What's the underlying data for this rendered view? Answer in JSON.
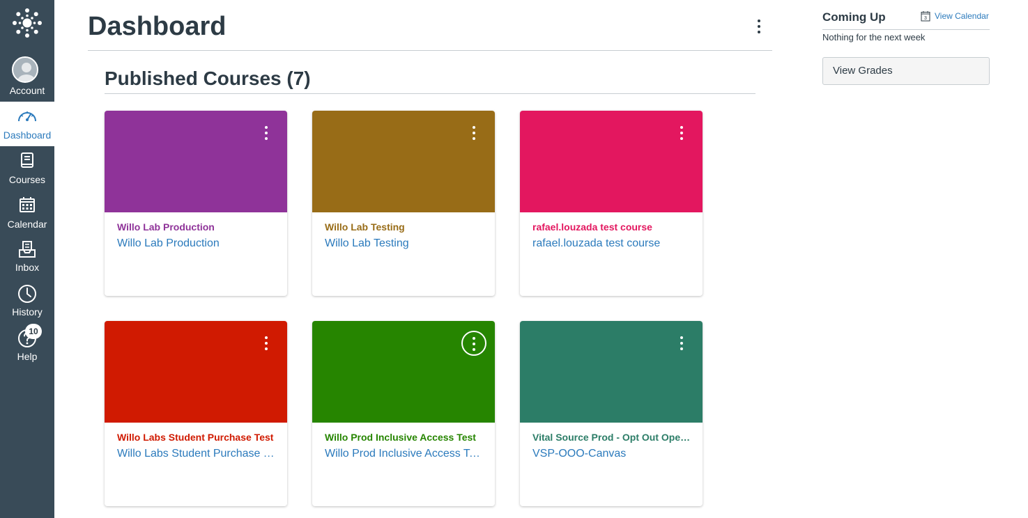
{
  "nav": {
    "account": "Account",
    "dashboard": "Dashboard",
    "courses": "Courses",
    "calendar": "Calendar",
    "inbox": "Inbox",
    "history": "History",
    "help": "Help",
    "help_badge": "10"
  },
  "header": {
    "title": "Dashboard"
  },
  "section": {
    "title": "Published Courses (7)"
  },
  "courses": [
    {
      "name": "Willo Lab Production",
      "code": "Willo Lab Production",
      "color": "#8f3399"
    },
    {
      "name": "Willo Lab Testing",
      "code": "Willo Lab Testing",
      "color": "#986c17"
    },
    {
      "name": "rafael.louzada test course",
      "code": "rafael.louzada test course",
      "color": "#e3175f"
    },
    {
      "name": "Willo Labs Student Purchase Test",
      "code": "Willo Labs Student Purchase Test",
      "color": "#d01a01"
    },
    {
      "name": "Willo Prod Inclusive Access Test",
      "code": "Willo Prod Inclusive Access Test",
      "color": "#268500"
    },
    {
      "name": "Vital Source Prod - Opt Out Open Access",
      "code": "VSP-OOO-Canvas",
      "color": "#2c7d67"
    }
  ],
  "sidebar": {
    "coming_up": "Coming Up",
    "view_calendar": "View Calendar",
    "calendar_day": "3",
    "nothing": "Nothing for the next week",
    "view_grades": "View Grades"
  },
  "colors": {
    "nav_bg": "#394b58",
    "link": "#2b7abc",
    "text": "#2d3b45"
  }
}
